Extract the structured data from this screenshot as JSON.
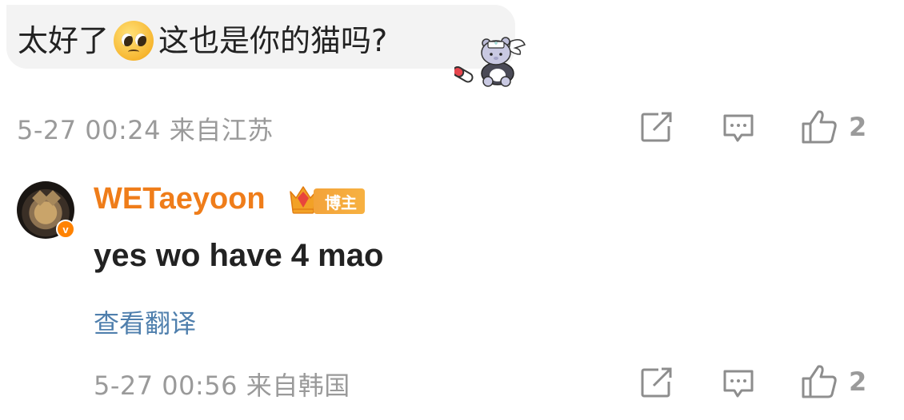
{
  "comment": {
    "text_before_emoji": "太好了",
    "emoji": "pleading-face",
    "text_after_emoji": "这也是你的猫吗?",
    "meta": "5-27 00:24 来自江苏",
    "like_count": "2"
  },
  "reply": {
    "username": "WETaeyoon",
    "badge_label": "博主",
    "verified_mark": "v",
    "text": "yes wo have 4 mao",
    "translate_label": "查看翻译",
    "meta": "5-27 00:56 来自韩国",
    "like_count": "2"
  },
  "icons": {
    "share": "share-icon",
    "comment": "comment-icon",
    "like": "thumbs-up-icon"
  },
  "colors": {
    "username": "#ef7d1a",
    "link": "#4f7fad",
    "meta": "#9a9a9a",
    "bubble": "#f3f3f3",
    "verified": "#ff8200"
  }
}
